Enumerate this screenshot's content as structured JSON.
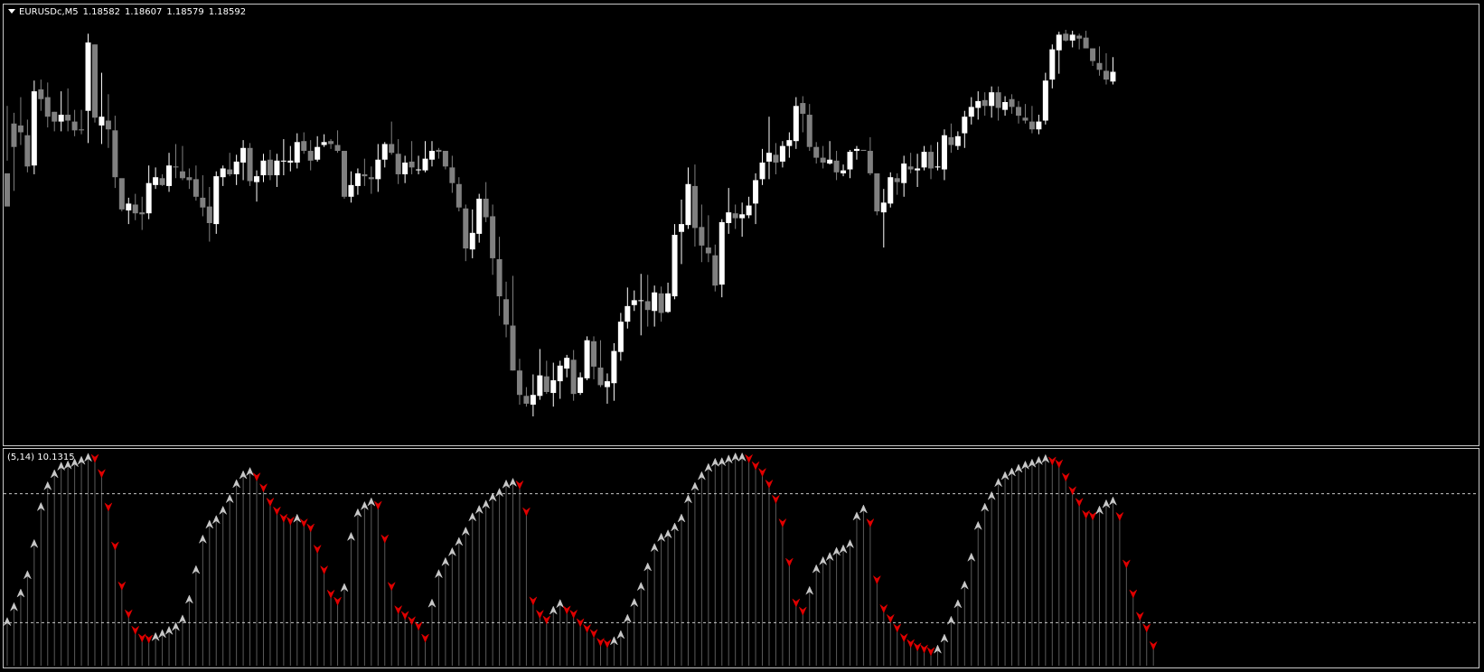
{
  "window": {
    "symbol_label": "EURUSDc,M5",
    "quote_open": "1.18582",
    "quote_high": "1.18607",
    "quote_low": "1.18579",
    "quote_close": "1.18592"
  },
  "indicator": {
    "label": "(5,14) 10.1315"
  },
  "colors": {
    "background": "#000000",
    "bull_candle": "#ffffff",
    "bear_candle": "#808080",
    "up_arrow": "#c8c8c8",
    "down_arrow": "#e00000",
    "histogram": "#5a5a5a",
    "level_line": "#c8c8c8",
    "border": "#c8c8c8"
  },
  "icons": {
    "collapse": "triangle-down-icon",
    "up_marker": "up-arrow-icon",
    "down_marker": "down-arrow-icon"
  },
  "chart_data": [
    {
      "type": "candlestick",
      "title": "EURUSDc,M5",
      "series_ohlc": [
        [
          1.18488,
          1.18557,
          1.18501,
          1.18454
        ],
        [
          1.18539,
          1.1855,
          1.1847,
          1.18515
        ],
        [
          1.18537,
          1.18566,
          1.18517,
          1.1853
        ],
        [
          1.18527,
          1.18543,
          1.18489,
          1.18495
        ],
        [
          1.18496,
          1.18583,
          1.18487,
          1.18572
        ],
        [
          1.18574,
          1.18584,
          1.18552,
          1.18564
        ],
        [
          1.18566,
          1.18581,
          1.18535,
          1.18546
        ],
        [
          1.18551,
          1.18551,
          1.18531,
          1.18541
        ],
        [
          1.18541,
          1.18572,
          1.18531,
          1.18548
        ],
        [
          1.18548,
          1.18575,
          1.18531,
          1.18542
        ],
        [
          1.18541,
          1.18553,
          1.18526,
          1.18532
        ],
        [
          1.18533,
          1.18553,
          1.18528,
          1.18532
        ],
        [
          1.18552,
          1.18631,
          1.18519,
          1.18622
        ],
        [
          1.1862,
          1.1862,
          1.1854,
          1.18545
        ],
        [
          1.18537,
          1.18591,
          1.18518,
          1.18546
        ],
        [
          1.18542,
          1.18569,
          1.18514,
          1.18533
        ],
        [
          1.18532,
          1.18547,
          1.18473,
          1.18484
        ],
        [
          1.18483,
          1.1848,
          1.18449,
          1.18451
        ],
        [
          1.1845,
          1.18463,
          1.18436,
          1.18457
        ],
        [
          1.18456,
          1.18467,
          1.1844,
          1.18447
        ],
        [
          1.18448,
          1.18464,
          1.1843,
          1.18446
        ],
        [
          1.18447,
          1.18496,
          1.18441,
          1.18478
        ],
        [
          1.18476,
          1.18494,
          1.18472,
          1.18484
        ],
        [
          1.18483,
          1.18487,
          1.18475,
          1.18476
        ],
        [
          1.18475,
          1.18509,
          1.18469,
          1.18496
        ],
        [
          1.18495,
          1.18518,
          1.18483,
          1.18494
        ],
        [
          1.1849,
          1.18516,
          1.18481,
          1.18483
        ],
        [
          1.18484,
          1.18493,
          1.18472,
          1.18481
        ],
        [
          1.18482,
          1.18496,
          1.1846,
          1.18464
        ],
        [
          1.18463,
          1.18486,
          1.18444,
          1.18453
        ],
        [
          1.18454,
          1.18474,
          1.18418,
          1.18437
        ],
        [
          1.18436,
          1.1849,
          1.18426,
          1.18485
        ],
        [
          1.18484,
          1.18496,
          1.18475,
          1.18493
        ],
        [
          1.18492,
          1.18509,
          1.18485,
          1.18487
        ],
        [
          1.18487,
          1.18507,
          1.18476,
          1.185
        ],
        [
          1.18499,
          1.18522,
          1.18481,
          1.18514
        ],
        [
          1.18514,
          1.18519,
          1.18475,
          1.1848
        ],
        [
          1.18479,
          1.18491,
          1.18459,
          1.18485
        ],
        [
          1.18486,
          1.18508,
          1.18479,
          1.18501
        ],
        [
          1.18502,
          1.18512,
          1.18481,
          1.18486
        ],
        [
          1.18486,
          1.18508,
          1.18474,
          1.18501
        ],
        [
          1.185,
          1.18523,
          1.18486,
          1.18501
        ],
        [
          1.18499,
          1.18516,
          1.1849,
          1.18501
        ],
        [
          1.18499,
          1.18529,
          1.18493,
          1.1852
        ],
        [
          1.18521,
          1.1853,
          1.18508,
          1.18511
        ],
        [
          1.18511,
          1.18522,
          1.18491,
          1.18501
        ],
        [
          1.18502,
          1.18526,
          1.185,
          1.18515
        ],
        [
          1.18517,
          1.18528,
          1.18515,
          1.1852
        ],
        [
          1.18521,
          1.18523,
          1.18513,
          1.18518
        ],
        [
          1.18517,
          1.18532,
          1.18509,
          1.18511
        ],
        [
          1.18511,
          1.18502,
          1.18462,
          1.18464
        ],
        [
          1.18464,
          1.1849,
          1.18458,
          1.18476
        ],
        [
          1.18475,
          1.18493,
          1.18466,
          1.18488
        ],
        [
          1.18487,
          1.18503,
          1.18475,
          1.18485
        ],
        [
          1.18484,
          1.18495,
          1.18467,
          1.18482
        ],
        [
          1.18482,
          1.18518,
          1.18469,
          1.18502
        ],
        [
          1.18502,
          1.1852,
          1.18494,
          1.18518
        ],
        [
          1.18518,
          1.18541,
          1.18507,
          1.18509
        ],
        [
          1.18508,
          1.18523,
          1.18477,
          1.18487
        ],
        [
          1.18487,
          1.18506,
          1.18478,
          1.18499
        ],
        [
          1.185,
          1.18521,
          1.18487,
          1.18494
        ],
        [
          1.18492,
          1.18506,
          1.18487,
          1.18492
        ],
        [
          1.18491,
          1.18521,
          1.18489,
          1.18503
        ],
        [
          1.18502,
          1.18521,
          1.18495,
          1.18511
        ],
        [
          1.18512,
          1.18514,
          1.18503,
          1.1851
        ],
        [
          1.18511,
          1.18511,
          1.18492,
          1.18495
        ],
        [
          1.18494,
          1.18506,
          1.18468,
          1.18478
        ],
        [
          1.18477,
          1.18484,
          1.18449,
          1.18453
        ],
        [
          1.18452,
          1.18456,
          1.18398,
          1.18411
        ],
        [
          1.1841,
          1.18451,
          1.18401,
          1.18427
        ],
        [
          1.18426,
          1.18467,
          1.18417,
          1.18462
        ],
        [
          1.18462,
          1.18479,
          1.18438,
          1.18443
        ],
        [
          1.18444,
          1.18456,
          1.18384,
          1.18401
        ],
        [
          1.184,
          1.18423,
          1.18342,
          1.18362
        ],
        [
          1.18359,
          1.18377,
          1.1832,
          1.18333
        ],
        [
          1.18332,
          1.18383,
          1.18286,
          1.18286
        ],
        [
          1.18286,
          1.18298,
          1.18251,
          1.18261
        ],
        [
          1.1826,
          1.18269,
          1.18249,
          1.18252
        ],
        [
          1.18251,
          1.18282,
          1.18239,
          1.18261
        ],
        [
          1.1826,
          1.18308,
          1.18256,
          1.18281
        ],
        [
          1.1828,
          1.18296,
          1.18262,
          1.18264
        ],
        [
          1.18263,
          1.18294,
          1.18249,
          1.18276
        ],
        [
          1.18275,
          1.18296,
          1.18257,
          1.18291
        ],
        [
          1.18288,
          1.18302,
          1.18279,
          1.18299
        ],
        [
          1.18297,
          1.18307,
          1.18255,
          1.18262
        ],
        [
          1.18263,
          1.18284,
          1.18261,
          1.18279
        ],
        [
          1.18278,
          1.18321,
          1.18276,
          1.18317
        ],
        [
          1.18316,
          1.18321,
          1.18277,
          1.1829
        ],
        [
          1.18289,
          1.18317,
          1.18269,
          1.18271
        ],
        [
          1.18269,
          1.18283,
          1.18252,
          1.18275
        ],
        [
          1.18273,
          1.18314,
          1.18255,
          1.18306
        ],
        [
          1.18305,
          1.18345,
          1.18296,
          1.18336
        ],
        [
          1.18336,
          1.18371,
          1.18329,
          1.18352
        ],
        [
          1.18353,
          1.18368,
          1.18347,
          1.18358
        ],
        [
          1.18358,
          1.18385,
          1.18322,
          1.18358
        ],
        [
          1.18357,
          1.18384,
          1.18331,
          1.18348
        ],
        [
          1.18347,
          1.18373,
          1.18331,
          1.18366
        ],
        [
          1.18365,
          1.18372,
          1.18336,
          1.18345
        ],
        [
          1.18346,
          1.18376,
          1.18345,
          1.18365
        ],
        [
          1.18362,
          1.18436,
          1.18359,
          1.18425
        ],
        [
          1.18428,
          1.18461,
          1.18395,
          1.18436
        ],
        [
          1.18435,
          1.18494,
          1.18431,
          1.18477
        ],
        [
          1.18475,
          1.18497,
          1.18413,
          1.18432
        ],
        [
          1.18433,
          1.18456,
          1.18397,
          1.18414
        ],
        [
          1.18412,
          1.18445,
          1.18397,
          1.18406
        ],
        [
          1.18404,
          1.18415,
          1.18367,
          1.18373
        ],
        [
          1.18374,
          1.18441,
          1.18361,
          1.18438
        ],
        [
          1.18437,
          1.18473,
          1.18426,
          1.18448
        ],
        [
          1.18447,
          1.18456,
          1.18431,
          1.18442
        ],
        [
          1.18442,
          1.18458,
          1.18423,
          1.18446
        ],
        [
          1.18445,
          1.18464,
          1.18442,
          1.18455
        ],
        [
          1.18457,
          1.18488,
          1.18436,
          1.18481
        ],
        [
          1.18482,
          1.18513,
          1.18476,
          1.18499
        ],
        [
          1.185,
          1.18546,
          1.18482,
          1.18509
        ],
        [
          1.18507,
          1.18519,
          1.18487,
          1.18499
        ],
        [
          1.185,
          1.18521,
          1.18494,
          1.18516
        ],
        [
          1.18516,
          1.1853,
          1.18504,
          1.18522
        ],
        [
          1.18521,
          1.18566,
          1.18513,
          1.18557
        ],
        [
          1.1856,
          1.18567,
          1.1853,
          1.18549
        ],
        [
          1.18548,
          1.18559,
          1.18511,
          1.18515
        ],
        [
          1.18515,
          1.1852,
          1.18498,
          1.18504
        ],
        [
          1.18504,
          1.18516,
          1.18493,
          1.18499
        ],
        [
          1.18498,
          1.18521,
          1.18497,
          1.18502
        ],
        [
          1.18501,
          1.18511,
          1.18481,
          1.18489
        ],
        [
          1.18488,
          1.18497,
          1.18485,
          1.18491
        ],
        [
          1.18492,
          1.18512,
          1.18483,
          1.1851
        ],
        [
          1.18511,
          1.18516,
          1.18502,
          1.18513
        ],
        [
          1.18512,
          1.18511,
          1.18511,
          1.18511
        ],
        [
          1.18511,
          1.18525,
          1.18486,
          1.18488
        ],
        [
          1.18488,
          1.18479,
          1.18445,
          1.18449
        ],
        [
          1.18448,
          1.18472,
          1.18412,
          1.18458
        ],
        [
          1.18457,
          1.18489,
          1.18453,
          1.18484
        ],
        [
          1.18483,
          1.18488,
          1.18466,
          1.18479
        ],
        [
          1.18478,
          1.18506,
          1.18464,
          1.18498
        ],
        [
          1.18495,
          1.18509,
          1.18488,
          1.18492
        ],
        [
          1.18491,
          1.18508,
          1.18474,
          1.18493
        ],
        [
          1.18494,
          1.18516,
          1.18491,
          1.1851
        ],
        [
          1.1851,
          1.18517,
          1.18482,
          1.18493
        ],
        [
          1.18494,
          1.1852,
          1.18491,
          1.18495
        ],
        [
          1.18492,
          1.18533,
          1.18481,
          1.18527
        ],
        [
          1.18525,
          1.18539,
          1.18509,
          1.18517
        ],
        [
          1.18516,
          1.18531,
          1.18512,
          1.18526
        ],
        [
          1.18529,
          1.18552,
          1.18514,
          1.18546
        ],
        [
          1.18546,
          1.18566,
          1.18538,
          1.18556
        ],
        [
          1.18555,
          1.18572,
          1.18543,
          1.18562
        ],
        [
          1.18563,
          1.18571,
          1.18547,
          1.18557
        ],
        [
          1.18557,
          1.18577,
          1.18545,
          1.18571
        ],
        [
          1.18571,
          1.18577,
          1.18542,
          1.18555
        ],
        [
          1.18553,
          1.18567,
          1.18547,
          1.18561
        ],
        [
          1.18564,
          1.18569,
          1.18549,
          1.18556
        ],
        [
          1.18556,
          1.18562,
          1.18539,
          1.18547
        ],
        [
          1.18545,
          1.18559,
          1.18539,
          1.18542
        ],
        [
          1.18541,
          1.18557,
          1.18529,
          1.18533
        ],
        [
          1.18533,
          1.18548,
          1.18528,
          1.18541
        ],
        [
          1.18542,
          1.18591,
          1.18538,
          1.18583
        ],
        [
          1.18584,
          1.1862,
          1.18575,
          1.18615
        ],
        [
          1.18614,
          1.18633,
          1.1859,
          1.1863
        ],
        [
          1.18631,
          1.18635,
          1.18623,
          1.18624
        ],
        [
          1.18624,
          1.18634,
          1.18617,
          1.1863
        ],
        [
          1.18629,
          1.18631,
          1.18615,
          1.18626
        ],
        [
          1.18627,
          1.18634,
          1.18616,
          1.18616
        ],
        [
          1.18616,
          1.18616,
          1.18598,
          1.18603
        ],
        [
          1.18601,
          1.18618,
          1.18588,
          1.18594
        ],
        [
          1.18593,
          1.18611,
          1.18579,
          1.18584
        ],
        [
          1.18582,
          1.18607,
          1.18579,
          1.18592
        ]
      ]
    },
    {
      "type": "line",
      "title": "(5,14) 10.1315",
      "levels": [
        80,
        20
      ],
      "ylim": [
        0,
        100
      ],
      "values": [
        20.3,
        27.2,
        33.6,
        42.1,
        56.6,
        73.8,
        83.5,
        89.1,
        92.6,
        93.2,
        94.2,
        95.3,
        96.7,
        96.6,
        89.6,
        74.0,
        55.9,
        37.3,
        24.3,
        16.7,
        13.1,
        12.6,
        13.3,
        14.7,
        16.2,
        18.0,
        21.5,
        30.7,
        44.5,
        58.7,
        65.6,
        67.8,
        72.1,
        77.5,
        84.5,
        88.6,
        90.1,
        88.0,
        82.9,
        76.3,
        72.2,
        68.8,
        67.5,
        68.4,
        66.6,
        64.3,
        54.4,
        44.7,
        33.5,
        30.2,
        36.2,
        59.9,
        70.9,
        74.2,
        76.0,
        74.8,
        59.2,
        37.1,
        26.2,
        23.6,
        21.1,
        18.6,
        13.0,
        28.9,
        42.6,
        48.2,
        52.8,
        57.6,
        62.4,
        69.0,
        72.5,
        74.9,
        78.2,
        80.4,
        84.3,
        85.1,
        84.3,
        71.8,
        30.3,
        24.1,
        21.5,
        25.6,
        28.7,
        26.1,
        24.2,
        20.2,
        17.5,
        15.2,
        11.1,
        10.4,
        11.4,
        14.3,
        21.8,
        29.2,
        36.7,
        45.8,
        54.8,
        59.5,
        61.1,
        64.3,
        68.5,
        77.4,
        83.2,
        88.2,
        92.0,
        94.4,
        94.7,
        95.9,
        96.9,
        96.9,
        96.5,
        93.2,
        90.1,
        84.7,
        77.6,
        66.6,
        48.3,
        29.4,
        25.6,
        34.8,
        44.9,
        48.6,
        50.6,
        53.0,
        54.1,
        56.5,
        69.4,
        72.7,
        66.6,
        40.1,
        26.7,
        22.1,
        17.7,
        13.2,
        10.5,
        8.9,
        8.0,
        6.8,
        7.5,
        12.6,
        20.9,
        28.6,
        37.3,
        50.3,
        65.0,
        73.5,
        78.9,
        85.0,
        88.2,
        89.9,
        91.6,
        93.1,
        94.0,
        95.2,
        96.1,
        95.4,
        94.1,
        87.9,
        81.6,
        76.2,
        70.5,
        69.8,
        72.2,
        75.1,
        76.4,
        69.6,
        47.5,
        33.6,
        23.2,
        17.7,
        9.5
      ]
    }
  ]
}
